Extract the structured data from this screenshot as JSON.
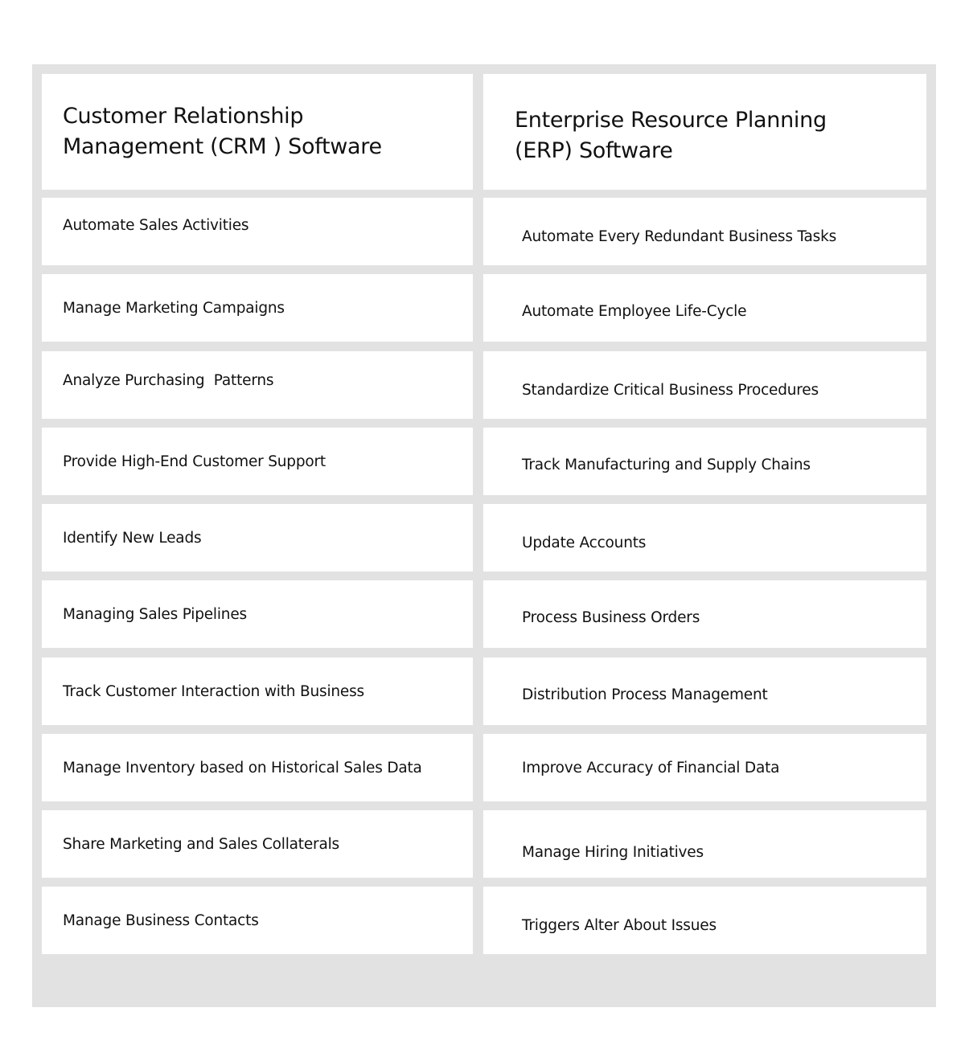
{
  "columns": [
    {
      "title": "Customer Relationship Management (CRM ) Software",
      "title_lines": [
        "Customer Relationship",
        "Management (CRM ) Software"
      ],
      "items": [
        "Automate Sales Activities",
        "Manage Marketing Campaigns",
        "Analyze Purchasing  Patterns",
        "Provide High-End Customer Support",
        "Identify New Leads",
        "Managing Sales Pipelines",
        "Track Customer Interaction with Business",
        "Manage Inventory based on Historical Sales Data",
        "Share Marketing and Sales Collaterals",
        "Manage Business Contacts"
      ]
    },
    {
      "title": "Enterprise Resource Planning (ERP) Software",
      "title_lines": [
        "Enterprise Resource Planning",
        "(ERP)  Software"
      ],
      "items": [
        "Automate Every Redundant Business Tasks",
        "Automate Employee Life-Cycle",
        "Standardize Critical Business Procedures",
        "Track Manufacturing and Supply Chains",
        "Update Accounts",
        "Process Business Orders",
        "Distribution Process Management",
        "Improve Accuracy of Financial Data",
        "Manage Hiring Initiatives",
        "Triggers Alter About Issues"
      ]
    }
  ],
  "colors": {
    "frame": "#e2e2e2",
    "cell": "#ffffff",
    "text": "#111111"
  }
}
